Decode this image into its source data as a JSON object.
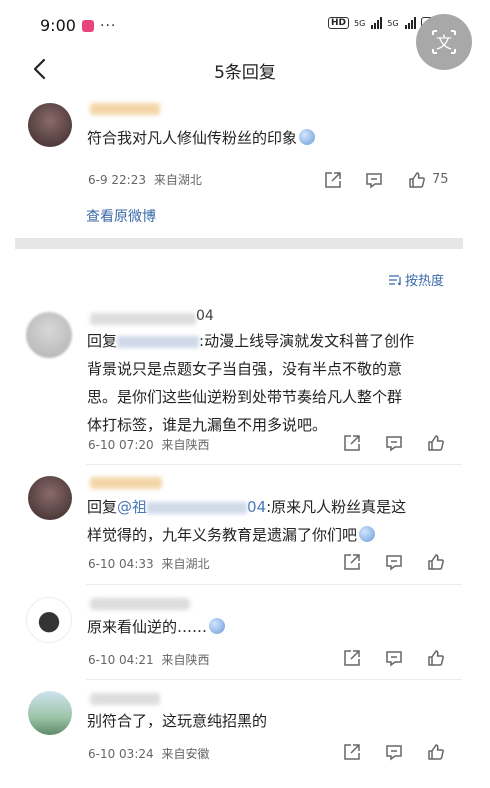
{
  "status_bar": {
    "time": "9:00",
    "more": "···",
    "hd_badge": "HD",
    "signal1_label": "5G",
    "signal2_label": "5G",
    "battery": "63"
  },
  "translate_button": {
    "glyph": "文"
  },
  "header": {
    "title": "5条回复"
  },
  "root_comment": {
    "text": "符合我对凡人修仙传粉丝的印象",
    "time": "6-9 22:23",
    "location": "来自湖北",
    "like_count": "75",
    "view_original": "查看原微博"
  },
  "sort": {
    "label": "按热度"
  },
  "replies": [
    {
      "name_suffix": "04",
      "reply_prefix": "回复",
      "text": ":动漫上线导演就发文科普了创作背景说只是点题女子当自强，没有半点不敬的意思。是你们这些仙逆粉到处带节奏给凡人整个群体打标签，谁是九漏鱼不用多说吧。",
      "line1": ":动漫上线导演就发文科普了创作",
      "line2": "背景说只是点题女子当自强，没有半点不敬的意",
      "line3": "思。是你们这些仙逆粉到处带节奏给凡人整个群",
      "line4": "体打标签，谁是九漏鱼不用多说吧。",
      "time": "6-10 07:20",
      "location": "来自陕西"
    },
    {
      "reply_prefix": "回复",
      "mention_start": "@祖",
      "mention_end": "04",
      "line1": ":原来凡人粉丝真是这",
      "line2": "样觉得的，九年义务教育是遗漏了你们吧",
      "time": "6-10 04:33",
      "location": "来自湖北"
    },
    {
      "text": "原来看仙逆的……",
      "time": "6-10 04:21",
      "location": "来自陕西"
    },
    {
      "text": "别符合了，这玩意纯招黑的",
      "time": "6-10 03:24",
      "location": "来自安徽"
    }
  ]
}
